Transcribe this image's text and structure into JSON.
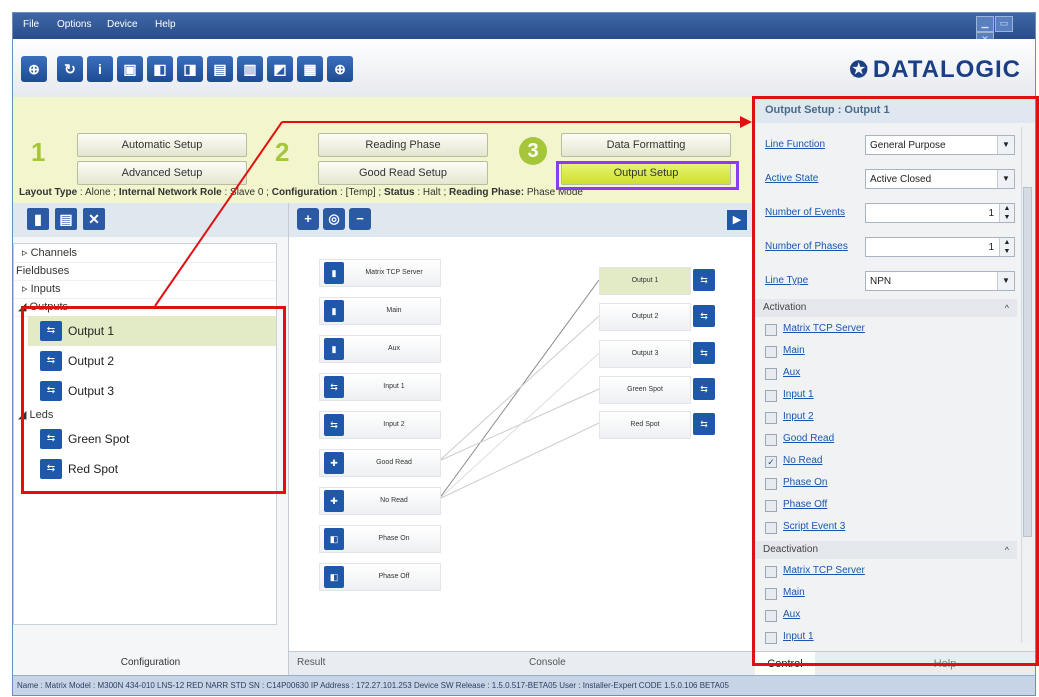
{
  "menu": {
    "file": "File",
    "options": "Options",
    "device": "Device",
    "help": "Help"
  },
  "window_controls": {
    "minimize": "▁",
    "restore": "▭",
    "close": "✕"
  },
  "logo": {
    "text": "DATALOGIC",
    "mark": "✪"
  },
  "status_line": {
    "layout_type_label": "Layout Type",
    "layout_type_value": "Alone",
    "network_role_label": "Internal Network Role",
    "network_role_value": "Slave 0",
    "configuration_label": "Configuration",
    "configuration_value": "[Temp]",
    "status_label": "Status",
    "status_value": "Halt",
    "reading_phase_label": "Reading Phase:",
    "reading_phase_value": "Phase Mode"
  },
  "steps": {
    "one": "1",
    "two": "2",
    "three": "3",
    "automatic_setup": "Automatic Setup",
    "advanced_setup": "Advanced Setup",
    "reading_phase": "Reading Phase",
    "good_read_setup": "Good Read Setup",
    "data_formatting": "Data Formatting",
    "output_setup": "Output Setup"
  },
  "tree": {
    "channels": "Channels",
    "fieldbuses": "Fieldbuses",
    "inputs": "Inputs",
    "outputs": "Outputs",
    "output1": "Output 1",
    "output2": "Output 2",
    "output3": "Output 3",
    "leds": "Leds",
    "green_spot": "Green Spot",
    "red_spot": "Red Spot"
  },
  "left_footer": "Configuration",
  "diagram": {
    "inputs": [
      "Matrix TCP Server",
      "Main",
      "Aux",
      "Input 1",
      "Input 2",
      "Good Read",
      "No Read",
      "Phase On",
      "Phase Off"
    ],
    "outputs": [
      "Output 1",
      "Output 2",
      "Output 3",
      "Green Spot",
      "Red Spot"
    ]
  },
  "center_tabs": {
    "result": "Result",
    "console": "Console"
  },
  "right_panel": {
    "title": "Output Setup : Output 1",
    "line_function_label": "Line Function",
    "line_function_value": "General Purpose",
    "active_state_label": "Active State",
    "active_state_value": "Active Closed",
    "num_events_label": "Number of Events",
    "num_events_value": "1",
    "num_phases_label": "Number of Phases",
    "num_phases_value": "1",
    "line_type_label": "Line Type",
    "line_type_value": "NPN",
    "activation_label": "Activation",
    "activation_items": [
      "Matrix TCP Server",
      "Main",
      "Aux",
      "Input 1",
      "Input 2",
      "Good Read",
      "No Read",
      "Phase On",
      "Phase Off",
      "Script Event 3"
    ],
    "activation_checked": [
      false,
      false,
      false,
      false,
      false,
      false,
      true,
      false,
      false,
      false
    ],
    "deactivation_label": "Deactivation",
    "deactivation_items": [
      "Matrix TCP Server",
      "Main",
      "Aux",
      "Input 1"
    ],
    "tab_control": "Control",
    "tab_help": "Help"
  },
  "statusbar": "Name : Matrix   Model : M300N 434-010 LNS-12 RED NARR STD   SN : C14P00630   IP Address : 172.27.101.253   Device SW Release : 1.5.0.517-BETA05   User : Installer-Expert   CODE 1.5.0.106 BETA05",
  "colors": {
    "accent": "#a6c63a",
    "highlight_red": "#e01010",
    "highlight_purple": "#8a3cf0",
    "brand": "#1b3f86"
  }
}
